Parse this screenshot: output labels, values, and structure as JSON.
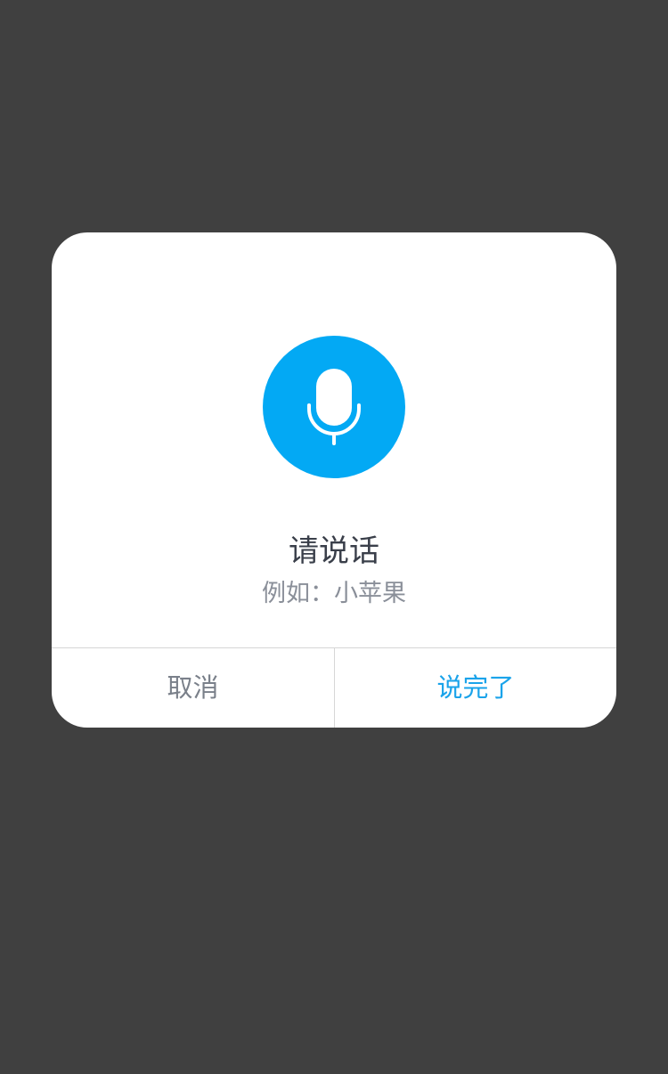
{
  "dialog": {
    "title": "请说话",
    "hint": "例如：小苹果",
    "cancel_label": "取消",
    "done_label": "说完了",
    "mic_icon": "microphone-icon"
  },
  "colors": {
    "backdrop": "#404040",
    "accent": "#03a9f4",
    "done_text": "#1aa3ea",
    "cancel_text": "#7a808a"
  }
}
